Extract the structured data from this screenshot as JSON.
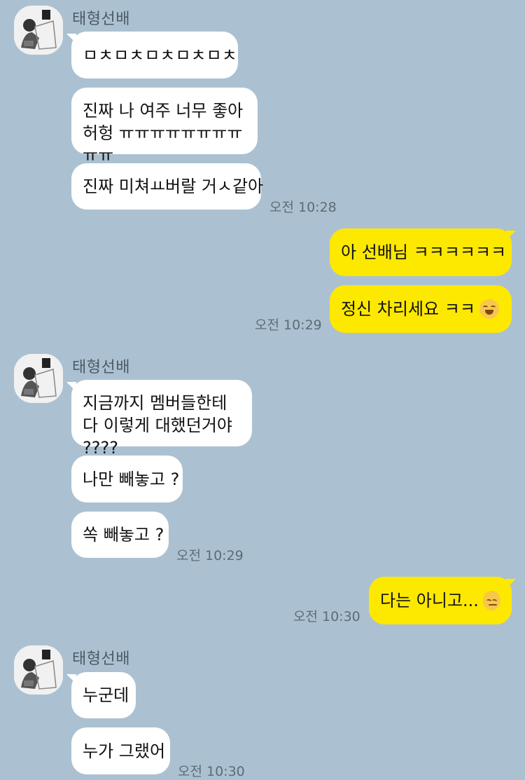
{
  "chat": {
    "group1": {
      "sender": "태형선배",
      "m1": "ㅁㅊㅁㅊㅁㅊㅁㅊㅁㅊ",
      "m2": "진짜 나 여주 너무 좋아 허헝 ㅠㅠㅠㅠㅠㅠㅠㅠㅠㅠ",
      "m3": "진짜 미쳐ㅛ버랄 거ㅅ같아",
      "time": "오전 10:28"
    },
    "group2": {
      "m1": "아 선배님 ㅋㅋㅋㅋㅋㅋ",
      "m2": "정신 차리세요 ㅋㅋ",
      "m2_emoji": "grinning-squinting-face-icon",
      "time": "오전 10:29"
    },
    "group3": {
      "sender": "태형선배",
      "m1": "지금까지 멤버들한테 다 이렇게 대했던거야 ????",
      "m2": "나만 빼놓고 ?",
      "m3": "쏙 빼놓고 ?",
      "time": "오전 10:29"
    },
    "group4": {
      "m1": "다는 아니고...",
      "m1_emoji": "pensive-face-icon",
      "time": "오전 10:30"
    },
    "group5": {
      "sender": "태형선배",
      "m1": "누군데",
      "m2": "누가 그랬어",
      "time": "오전 10:30"
    }
  },
  "colors": {
    "background": "#abc1d1",
    "incoming_bubble": "#ffffff",
    "outgoing_bubble": "#fde800"
  }
}
